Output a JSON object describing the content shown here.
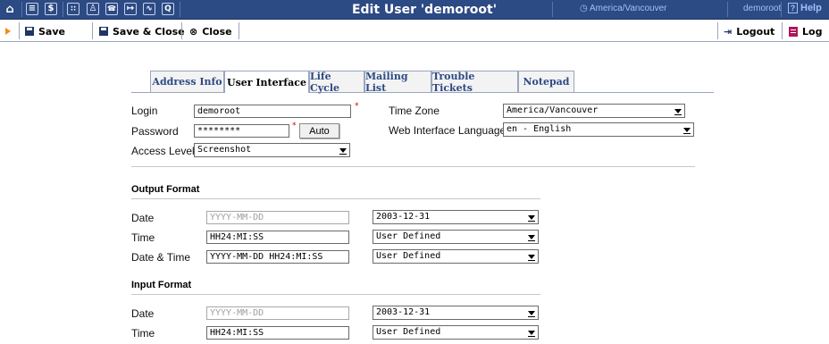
{
  "header": {
    "title": "Edit User 'demoroot'",
    "timezone": "America/Vancouver",
    "user": "demoroot",
    "help": "Help",
    "nav_icons": [
      "home-icon",
      "list-icon",
      "dollar-icon",
      "grid-icon",
      "person-icon",
      "phone-icon",
      "export-icon",
      "chart-icon",
      "search-icon"
    ]
  },
  "toolbar": {
    "save": "Save",
    "save_close": "Save & Close",
    "close": "Close",
    "logout": "Logout",
    "log": "Log"
  },
  "tabs": [
    "Address Info",
    "User Interface",
    "Life Cycle",
    "Mailing List",
    "Trouble Tickets",
    "Notepad"
  ],
  "active_tab": "User Interface",
  "form": {
    "login_label": "Login",
    "login_value": "demoroot",
    "password_label": "Password",
    "password_value": "********",
    "auto_button": "Auto",
    "access_level_label": "Access Level",
    "access_level_value": "Screenshot",
    "timezone_label": "Time Zone",
    "timezone_value": "America/Vancouver",
    "language_label": "Web Interface Language",
    "language_value": "en - English",
    "required_mark": "*"
  },
  "output_format": {
    "title": "Output Format",
    "rows": [
      {
        "label": "Date",
        "value": "YYYY-MM-DD",
        "placeholder": true,
        "select": "2003-12-31"
      },
      {
        "label": "Time",
        "value": "HH24:MI:SS",
        "placeholder": false,
        "select": "User Defined"
      },
      {
        "label": "Date & Time",
        "value": "YYYY-MM-DD HH24:MI:SS",
        "placeholder": false,
        "select": "User Defined"
      }
    ]
  },
  "input_format": {
    "title": "Input Format",
    "rows": [
      {
        "label": "Date",
        "value": "YYYY-MM-DD",
        "placeholder": true,
        "select": "2003-12-31"
      },
      {
        "label": "Time",
        "value": "HH24:MI:SS",
        "placeholder": false,
        "select": "User Defined"
      }
    ]
  }
}
